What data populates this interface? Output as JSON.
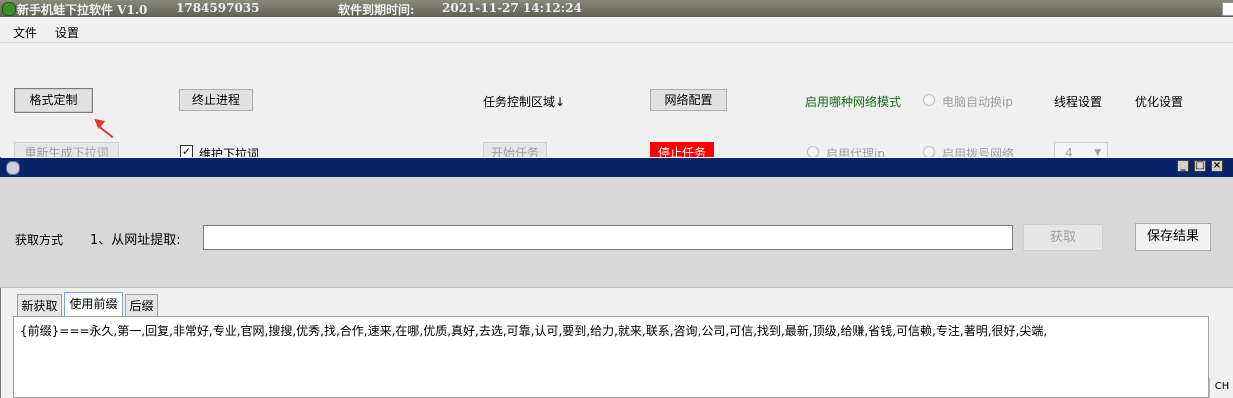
{
  "window": {
    "title": "新手机蛙下拉软件 V1.0",
    "phone": "1784597035",
    "expire_label": "软件到期时间:",
    "expire_value": "2021-11-27 14:12:24"
  },
  "menu": [
    "文件",
    "设置"
  ],
  "toolbar": {
    "format_button": "格式定制",
    "stop_process_button": "终止进程",
    "task_area_label": "任务控制区域↓",
    "network_config_button": "网络配置",
    "network_mode_label": "启用哪种网络模式",
    "auto_ip_radio": "电脑自动换ip",
    "thread_settings": "线程设置",
    "optimize_settings": "优化设置",
    "regenerate_button": "重新生成下拉词",
    "maintain_checkbox": "维护下拉词",
    "start_task_button": "开始任务",
    "stop_task_button": "停止任务",
    "proxy_radio": "启用代理ip",
    "dialup_radio": "启用拨号网络",
    "thread_value": "4"
  },
  "colors": {
    "mode_label": "#1a6b1a",
    "stop_task_bg": "#ff0000",
    "child_title_bg": "#0a246a"
  },
  "child": {
    "window_controls": [
      "_",
      "□",
      "×"
    ],
    "fetch_method_label": "获取方式",
    "from_url_label": "1、从网址提取:",
    "url_value": "",
    "fetch_button": "获取",
    "save_button": "保存结果",
    "tabs": [
      "新获取",
      "使用前缀",
      "后缀"
    ],
    "active_tab": "使用前缀",
    "content": "{前缀}===永久,第一,回复,非常好,专业,官网,搜搜,优秀,找,合作,速来,在哪,优质,真好,去选,可靠,认可,要到,给力,就来,联系,咨询,公司,可信,找到,最新,顶级,给赚,省钱,可信赖,专注,著明,很好,尖端,"
  },
  "ime_indicator": "CH"
}
